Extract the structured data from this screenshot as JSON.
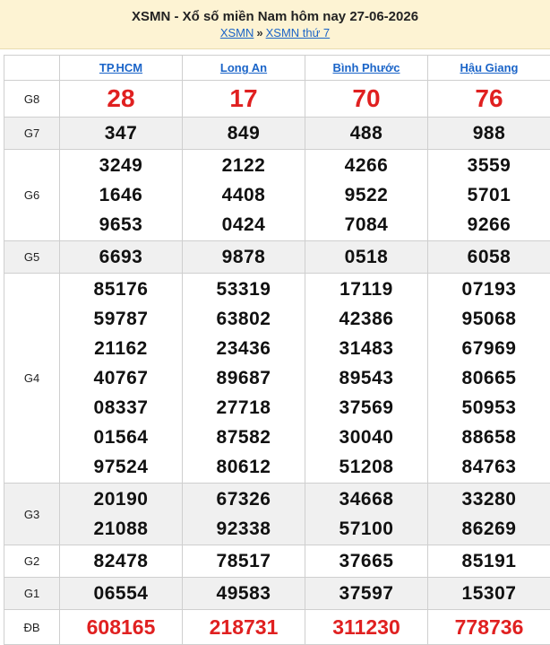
{
  "header": {
    "title": "XSMN - Xổ số miền Nam hôm nay 27-06-2026",
    "link1": "XSMN",
    "separator": "»",
    "link2": "XSMN thứ 7"
  },
  "provinces": [
    "TP.HCM",
    "Long An",
    "Bình Phước",
    "Hậu Giang"
  ],
  "prizes": [
    {
      "label": "G8",
      "style": "red",
      "values": [
        [
          "28"
        ],
        [
          "17"
        ],
        [
          "70"
        ],
        [
          "76"
        ]
      ]
    },
    {
      "label": "G7",
      "style": "normal",
      "values": [
        [
          "347"
        ],
        [
          "849"
        ],
        [
          "488"
        ],
        [
          "988"
        ]
      ]
    },
    {
      "label": "G6",
      "style": "normal",
      "values": [
        [
          "3249",
          "1646",
          "9653"
        ],
        [
          "2122",
          "4408",
          "0424"
        ],
        [
          "4266",
          "9522",
          "7084"
        ],
        [
          "3559",
          "5701",
          "9266"
        ]
      ]
    },
    {
      "label": "G5",
      "style": "normal",
      "values": [
        [
          "6693"
        ],
        [
          "9878"
        ],
        [
          "0518"
        ],
        [
          "6058"
        ]
      ]
    },
    {
      "label": "G4",
      "style": "normal",
      "values": [
        [
          "85176",
          "59787",
          "21162",
          "40767",
          "08337",
          "01564",
          "97524"
        ],
        [
          "53319",
          "63802",
          "23436",
          "89687",
          "27718",
          "87582",
          "80612"
        ],
        [
          "17119",
          "42386",
          "31483",
          "89543",
          "37569",
          "30040",
          "51208"
        ],
        [
          "07193",
          "95068",
          "67969",
          "80665",
          "50953",
          "88658",
          "84763"
        ]
      ]
    },
    {
      "label": "G3",
      "style": "normal",
      "values": [
        [
          "20190",
          "21088"
        ],
        [
          "67326",
          "92338"
        ],
        [
          "34668",
          "57100"
        ],
        [
          "33280",
          "86269"
        ]
      ]
    },
    {
      "label": "G2",
      "style": "normal",
      "values": [
        [
          "82478"
        ],
        [
          "78517"
        ],
        [
          "37665"
        ],
        [
          "85191"
        ]
      ]
    },
    {
      "label": "G1",
      "style": "normal",
      "values": [
        [
          "06554"
        ],
        [
          "49583"
        ],
        [
          "37597"
        ],
        [
          "15307"
        ]
      ]
    },
    {
      "label": "ĐB",
      "style": "db",
      "values": [
        [
          "608165"
        ],
        [
          "218731"
        ],
        [
          "311230"
        ],
        [
          "778736"
        ]
      ]
    }
  ],
  "colors": {
    "accent_red": "#e02020",
    "link_blue": "#1a64c8",
    "header_bg": "#fdf3d3",
    "alt_row": "#f0f0f0"
  }
}
